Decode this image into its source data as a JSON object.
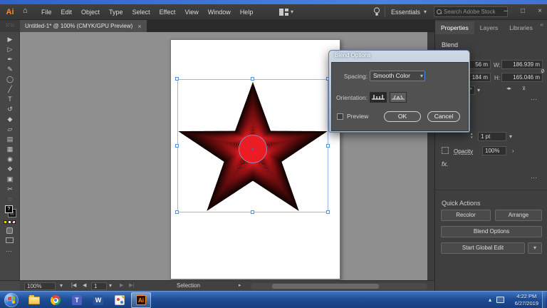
{
  "colors": {
    "accent": "#3f8ae0",
    "orange": "#ff8a1d",
    "red": "#ec1c24",
    "taskbar": "#1f4d96",
    "desktop": "#3568cf"
  },
  "icons": {
    "home": "⌂",
    "chevron": "▾",
    "close": "×",
    "minimize": "–",
    "maximize": "□",
    "more": "…",
    "collapse": "«",
    "tray_arrow": "▴",
    "opacity_arrow": "›",
    "nav_first": "|◀",
    "nav_prev": "◀",
    "nav_next": "▶",
    "nav_last": "▶|",
    "status_flyout": "▸",
    "stepper_up": "▲",
    "stepper_down": "▼",
    "flip_h": "◂▸",
    "flip_v": "⊻",
    "chain": "ø",
    "fx": "fx.",
    "swatch_question": "?",
    "tools_corner": "⁙⁙"
  },
  "menubar": {
    "logo": "Ai",
    "items": [
      "File",
      "Edit",
      "Object",
      "Type",
      "Select",
      "Effect",
      "View",
      "Window",
      "Help"
    ],
    "workspace": "Essentials",
    "search_placeholder": "Search Adobe Stock"
  },
  "document_tab": {
    "title": "Untitled-1* @ 100% (CMYK/GPU Preview)"
  },
  "toolbar": {
    "tools": [
      {
        "name": "selection-tool",
        "glyph": "▶"
      },
      {
        "name": "direct-selection-tool",
        "glyph": "▷"
      },
      {
        "name": "pen-tool",
        "glyph": "✒"
      },
      {
        "name": "curvature-tool",
        "glyph": "✎"
      },
      {
        "name": "lasso-tool",
        "glyph": "◯"
      },
      {
        "name": "paintbrush-tool",
        "glyph": "╱"
      },
      {
        "name": "type-tool",
        "glyph": "T"
      },
      {
        "name": "rotate-tool",
        "glyph": "↺"
      },
      {
        "name": "eraser-tool",
        "glyph": "◆"
      },
      {
        "name": "scale-tool",
        "glyph": "▱"
      },
      {
        "name": "width-tool",
        "glyph": "▤"
      },
      {
        "name": "mesh-tool",
        "glyph": "▦"
      },
      {
        "name": "eyedropper-tool",
        "glyph": "◉"
      },
      {
        "name": "blend-tool",
        "glyph": "❖"
      },
      {
        "name": "artboard-tool",
        "glyph": "▣"
      },
      {
        "name": "slice-tool",
        "glyph": "✂"
      },
      {
        "name": "zoom-tool",
        "glyph": "◌"
      }
    ]
  },
  "dialog": {
    "title": "Blend Options",
    "spacing_label": "Spacing:",
    "spacing_value": "Smooth Color",
    "orientation_label": "Orientation:",
    "preview_label": "Preview",
    "ok": "OK",
    "cancel": "Cancel"
  },
  "panel": {
    "tabs": [
      "Properties",
      "Layers",
      "Libraries"
    ],
    "object_type": "Blend",
    "transform": {
      "x_partial": "56 m",
      "y_partial": "184 m",
      "rotate_partial": "2°",
      "w_label": "W:",
      "w_value": "186.939 m",
      "h_label": "H:",
      "h_value": "165.046 m"
    },
    "appearance": {
      "stroke_value": "1 pt",
      "opacity_label": "Opacity",
      "opacity_value": "100%"
    },
    "quick_actions": {
      "label": "Quick Actions",
      "recolor": "Recolor",
      "arrange": "Arrange",
      "blend_options": "Blend Options",
      "start_global_edit": "Start Global Edit"
    }
  },
  "statusbar": {
    "zoom": "100%",
    "artboard": "1",
    "tool": "Selection"
  },
  "taskbar": {
    "items": [
      "start",
      "explorer",
      "chrome",
      "teams",
      "word",
      "paint",
      "illustrator"
    ],
    "word_glyph": "W",
    "teams_glyph": "T",
    "ai_glyph": "Ai",
    "clock_time": "4:22 PM",
    "clock_date": "6/27/2019"
  }
}
